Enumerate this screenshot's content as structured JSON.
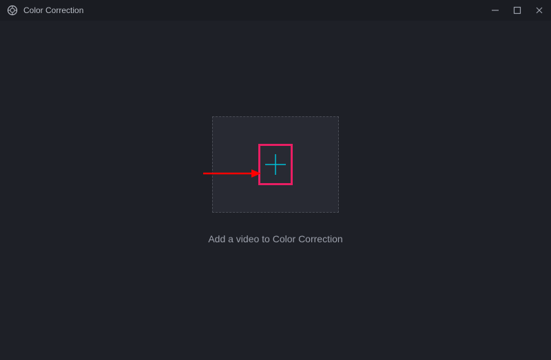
{
  "titlebar": {
    "title": "Color Correction"
  },
  "main": {
    "instruction": "Add a video to Color Correction"
  },
  "colors": {
    "accent": "#00bcd4",
    "highlight": "#e91e63",
    "arrow": "#ff0000"
  }
}
